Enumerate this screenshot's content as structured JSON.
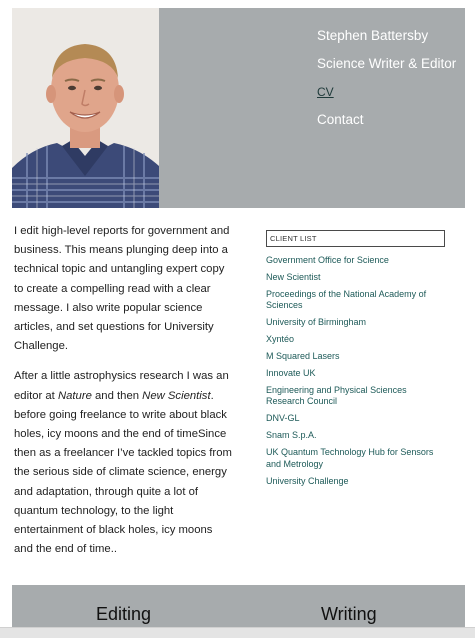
{
  "header": {
    "nav": [
      {
        "label": "Stephen Battersby"
      },
      {
        "label": "Science Writer & Editor"
      },
      {
        "label": "CV"
      },
      {
        "label": "Contact"
      }
    ]
  },
  "bio": {
    "p1": "I edit high-level reports for government and business. This means plunging deep into a technical topic and untangling expert copy to create a compelling read with a clear message. I also write popular science articles, and set questions for University Challenge.",
    "p2_a": "After a little astrophysics research I was an editor at ",
    "p2_nature": "Nature",
    "p2_b": " and then ",
    "p2_ns": "New Scientist",
    "p2_c": ". before going freelance to write about black holes, icy moons and the end of timeSince then as a freelancer I’ve tackled topics from the serious side of climate science, energy and adaptation, through quite a lot of quantum technology, to the light entertainment of black holes, icy moons and the end of time.."
  },
  "clients": {
    "input_value": "CLIENT LIST",
    "items": [
      "Government Office for Science",
      "New Scientist",
      "Proceedings of the National Academy of Sciences",
      "University of Birmingham",
      "Xyntéo",
      "M Squared Lasers",
      "Innovate UK",
      "Engineering and Physical Sciences Research Council",
      "DNV-GL",
      "Snam S.p.A.",
      "UK Quantum Technology Hub for Sensors and Metrology",
      "University Challenge"
    ]
  },
  "bottom": {
    "editing": "Editing",
    "writing": "Writing"
  },
  "colors": {
    "band": "#a7abad",
    "link": "#1d5a58"
  }
}
